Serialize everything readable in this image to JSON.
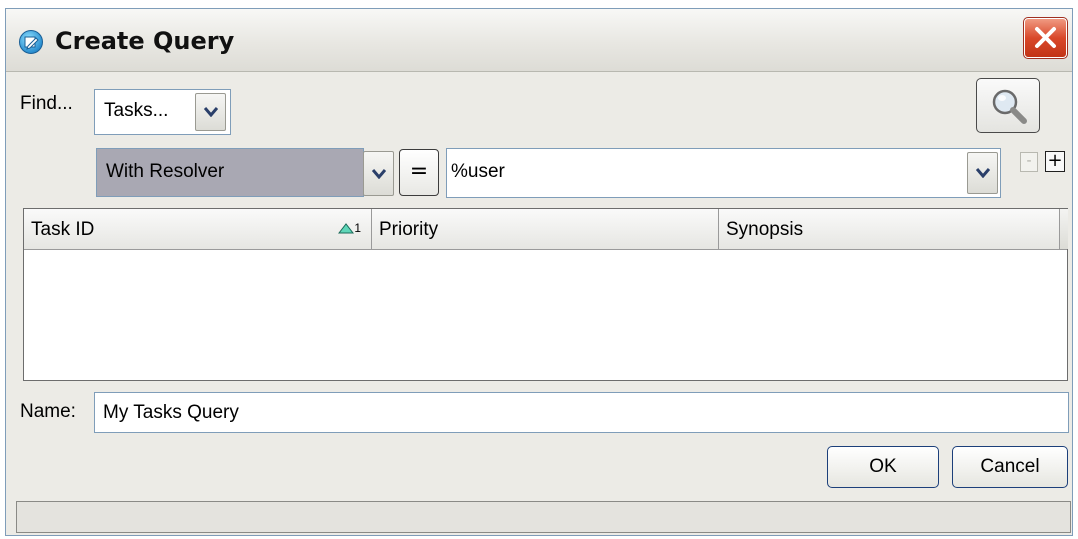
{
  "window": {
    "title": "Create Query"
  },
  "find": {
    "label": "Find...",
    "type_value": "Tasks...",
    "search_icon": "magnifier-icon"
  },
  "criteria": {
    "field_value": "With Resolver",
    "operator_label": "=",
    "value_text": "%user",
    "remove_label": "-",
    "add_label": "+"
  },
  "table": {
    "columns": [
      {
        "label": "Task ID",
        "sort_order": "1"
      },
      {
        "label": "Priority"
      },
      {
        "label": "Synopsis"
      }
    ],
    "rows": []
  },
  "name": {
    "label": "Name:",
    "value": "My Tasks Query"
  },
  "buttons": {
    "ok_label": "OK",
    "cancel_label": "Cancel"
  },
  "colors": {
    "accent": "#2b8fd0",
    "close": "#d9482a",
    "selected_field": "#a9a8b3"
  }
}
